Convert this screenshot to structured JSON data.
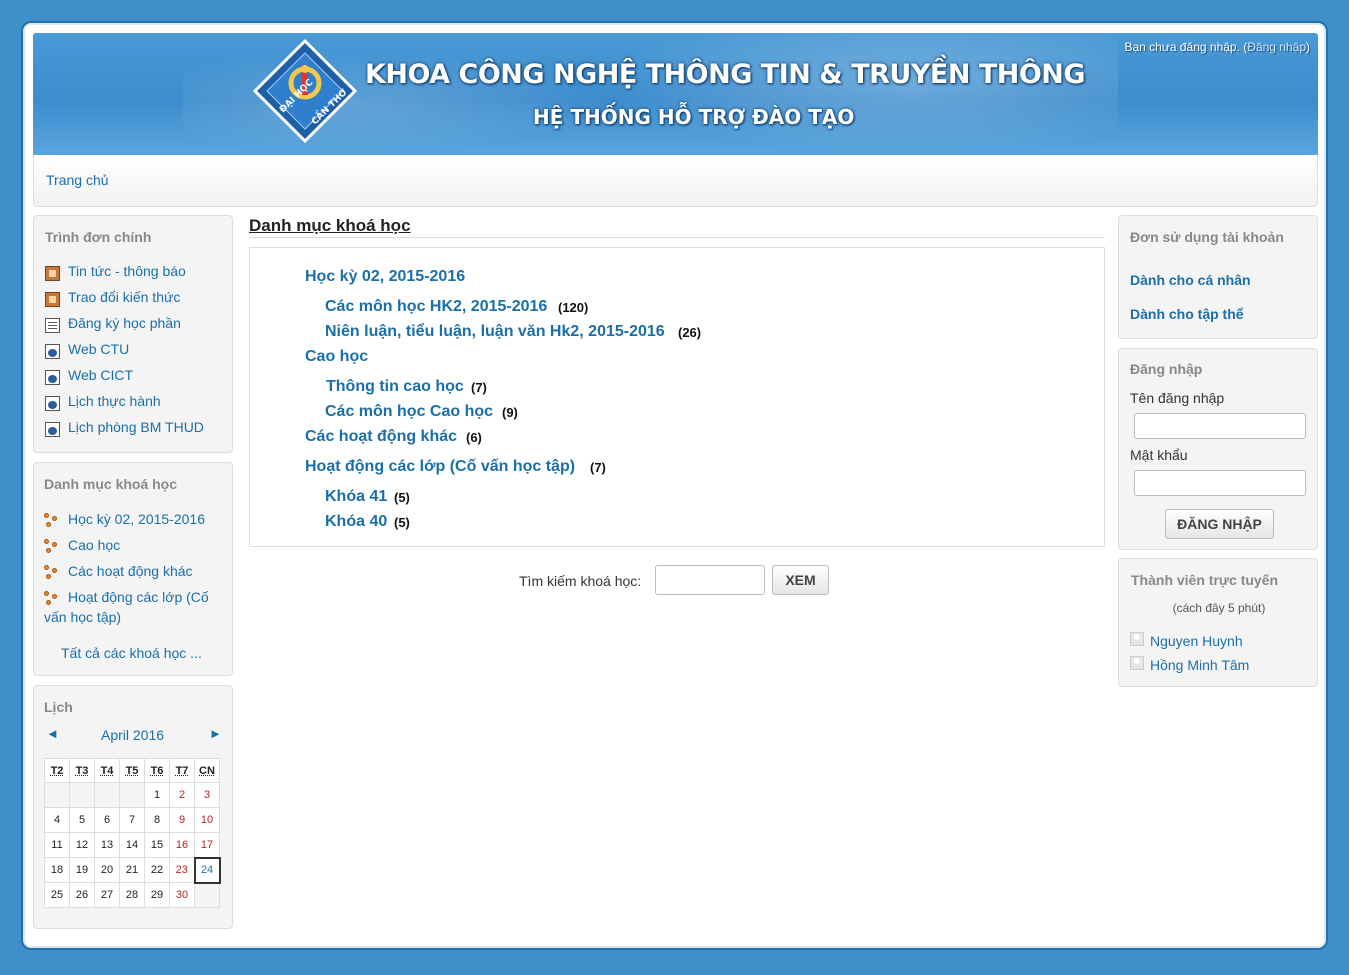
{
  "header": {
    "title": "KHOA CÔNG NGHỆ THÔNG TIN & TRUYỀN THÔNG",
    "subtitle": "HỆ THỐNG HỖ TRỢ ĐÀO TẠO",
    "logo_text_top": "ĐẠI HỌC",
    "logo_text_bottom": "CẦN THƠ",
    "login_status_prefix": "Bạn chưa đăng nhập. (",
    "login_link": "Đăng nhập",
    "login_status_suffix": ")"
  },
  "nav": {
    "home": "Trang chủ"
  },
  "main_menu": {
    "title": "Trình đơn chính",
    "items": [
      {
        "label": "Tin tức - thông báo",
        "icon": "forum-icon"
      },
      {
        "label": "Trao đổi kiến thức",
        "icon": "forum-icon"
      },
      {
        "label": "Đăng ký học phần",
        "icon": "document-icon"
      },
      {
        "label": "Web CTU",
        "icon": "web-link-icon"
      },
      {
        "label": "Web CICT",
        "icon": "web-link-icon"
      },
      {
        "label": "Lịch thực hành",
        "icon": "web-link-icon"
      },
      {
        "label": "Lịch phòng BM THUD",
        "icon": "web-link-icon"
      }
    ]
  },
  "course_categories_block": {
    "title": "Danh mục khoá học",
    "items": [
      {
        "label": "Học kỳ 02, 2015-2016"
      },
      {
        "label": "Cao học"
      },
      {
        "label": "Các hoạt động khác"
      },
      {
        "label_line1": "Hoạt động các lớp (Cố",
        "label_line2": "vấn học tập)"
      }
    ],
    "all_courses": "Tất cả các khoá học ..."
  },
  "calendar": {
    "title": "Lịch",
    "month": "April 2016",
    "prev": "◄",
    "next": "►",
    "days": [
      "T2",
      "T3",
      "T4",
      "T5",
      "T6",
      "T7",
      "CN"
    ],
    "weeks": [
      [
        "",
        "",
        "",
        "",
        "1",
        "2",
        "3"
      ],
      [
        "4",
        "5",
        "6",
        "7",
        "8",
        "9",
        "10"
      ],
      [
        "11",
        "12",
        "13",
        "14",
        "15",
        "16",
        "17"
      ],
      [
        "18",
        "19",
        "20",
        "21",
        "22",
        "23",
        "24"
      ],
      [
        "25",
        "26",
        "27",
        "28",
        "29",
        "30",
        ""
      ]
    ],
    "today": "24"
  },
  "main": {
    "heading": "Danh mục khoá học",
    "categories": [
      {
        "name": "Học kỳ 02, 2015-2016",
        "count": ""
      },
      {
        "name": "Các môn học HK2, 2015-2016",
        "count": "(120)"
      },
      {
        "name": "Niên luận, tiểu luận, luận văn Hk2, 2015-2016",
        "count": "(26)"
      },
      {
        "name": "Cao học",
        "count": ""
      },
      {
        "name": "Thông tin cao học",
        "count": "(7)"
      },
      {
        "name": "Các môn học Cao học",
        "count": "(9)"
      },
      {
        "name": "Các hoạt động khác",
        "count": "(6)"
      },
      {
        "name": "Hoạt động các lớp (Cố vấn học tập)",
        "count": "(7)"
      },
      {
        "name": "Khóa 41",
        "count": "(5)"
      },
      {
        "name": "Khóa 40",
        "count": "(5)"
      }
    ],
    "search_label": "Tìm kiếm khoá học:",
    "search_button": "XEM"
  },
  "account_block": {
    "title": "Đơn sử dụng tài khoản",
    "links": [
      "Dành cho cá nhân",
      "Dành cho tập thể"
    ]
  },
  "login_block": {
    "title": "Đăng nhập",
    "username_label": "Tên đăng nhập",
    "password_label": "Mật khẩu",
    "button": "ĐĂNG NHẬP"
  },
  "online_block": {
    "title": "Thành viên trực tuyến",
    "subtitle": "(cách đây 5 phút)",
    "users": [
      "Nguyen Huynh",
      "Hồng Minh Tâm"
    ]
  }
}
